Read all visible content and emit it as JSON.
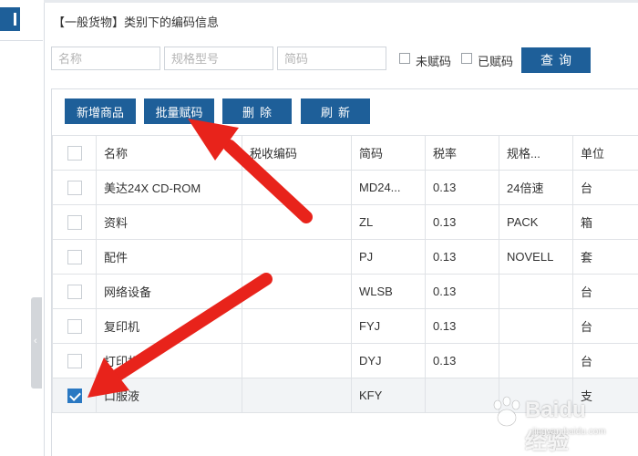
{
  "page_title": "【一般货物】类别下的编码信息",
  "search": {
    "name_placeholder": "名称",
    "spec_placeholder": "规格型号",
    "short_placeholder": "简码",
    "unassigned_label": "未赋码",
    "assigned_label": "已赋码",
    "query_label": "查询"
  },
  "toolbar": {
    "add_label": "新增商品",
    "batch_label": "批量赋码",
    "delete_label": "删除",
    "refresh_label": "刷新"
  },
  "table": {
    "headers": [
      "名称",
      "税收编码",
      "简码",
      "税率",
      "规格...",
      "单位"
    ],
    "rows": [
      {
        "name": "美达24X CD-ROM",
        "tax_code": "",
        "short": "MD24...",
        "rate": "0.13",
        "spec": "24倍速",
        "unit": "台",
        "checked": false
      },
      {
        "name": "资料",
        "tax_code": "",
        "short": "ZL",
        "rate": "0.13",
        "spec": "PACK",
        "unit": "箱",
        "checked": false
      },
      {
        "name": "配件",
        "tax_code": "",
        "short": "PJ",
        "rate": "0.13",
        "spec": "NOVELL",
        "unit": "套",
        "checked": false
      },
      {
        "name": "网络设备",
        "tax_code": "",
        "short": "WLSB",
        "rate": "0.13",
        "spec": "",
        "unit": "台",
        "checked": false
      },
      {
        "name": "复印机",
        "tax_code": "",
        "short": "FYJ",
        "rate": "0.13",
        "spec": "",
        "unit": "台",
        "checked": false
      },
      {
        "name": "打印机",
        "tax_code": "",
        "short": "DYJ",
        "rate": "0.13",
        "spec": "",
        "unit": "台",
        "checked": false
      },
      {
        "name": "口服液",
        "tax_code": "",
        "short": "KFY",
        "rate": "",
        "spec": "",
        "unit": "支",
        "checked": true
      }
    ]
  },
  "colors": {
    "primary": "#1e5f99",
    "arrow": "#e8231b",
    "check": "#2a78c2"
  },
  "icons": {
    "collapse": "chevron-left-icon",
    "check": "check-icon"
  },
  "watermark": {
    "text": "Baidu经验",
    "sub": "jingyan.baidu.com"
  }
}
